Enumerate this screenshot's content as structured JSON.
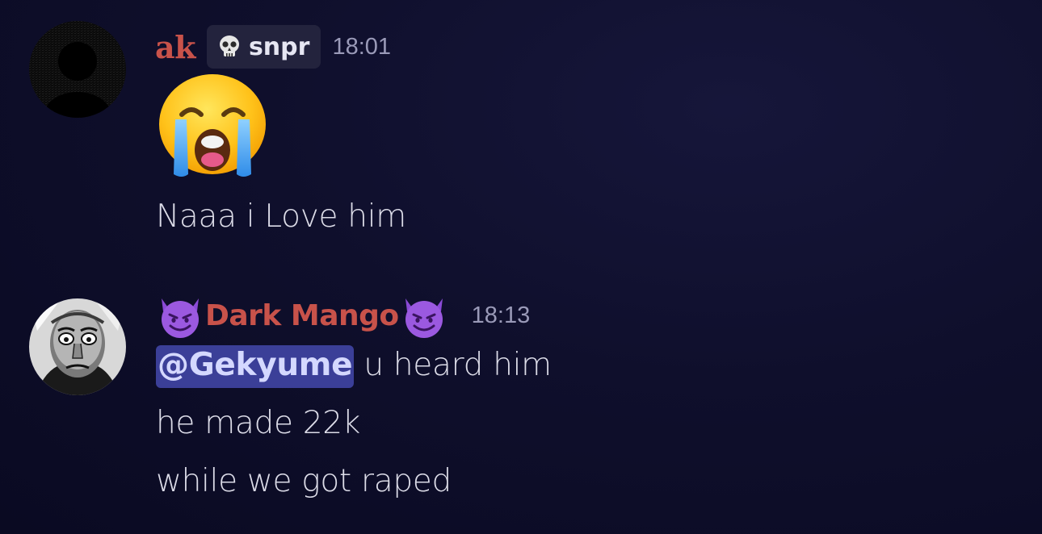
{
  "messages": [
    {
      "author": "ak",
      "tag": "snpr",
      "tag_icon": "skull-icon",
      "timestamp": "18:01",
      "avatar_icon": "dark-silhouette-avatar",
      "emoji": "loudly-crying-face-emoji",
      "lines": [
        "Naaa i Love him"
      ]
    },
    {
      "author": "Dark Mango",
      "author_decoration_icon": "smiling-devil-icon",
      "timestamp": "18:13",
      "avatar_icon": "grayscale-cartoon-face-avatar",
      "mention": "@Gekyume",
      "lines": [
        " u heard him",
        "he made 22k",
        "while we got raped"
      ]
    }
  ],
  "colors": {
    "background": "#0f0f2c",
    "username": "#c8524a",
    "mention_bg": "#3b3f98",
    "timestamp": "#9a9ab8",
    "tag_bg": "#23233d"
  }
}
